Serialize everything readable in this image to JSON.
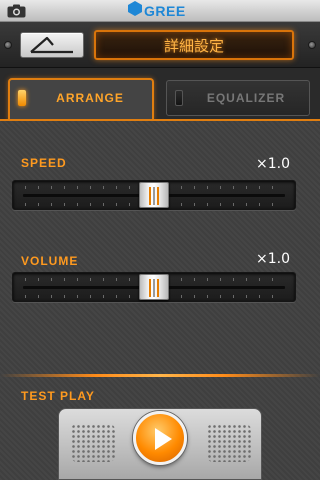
{
  "status_bar": {
    "brand": "GREE",
    "icons": [
      "camera-icon",
      "gree-logo-icon"
    ]
  },
  "header": {
    "title": "詳細設定",
    "back_icon": "back-arrow-icon"
  },
  "tabs": [
    {
      "label": "ARRANGE",
      "active": true
    },
    {
      "label": "EQUALIZER",
      "active": false
    }
  ],
  "speed": {
    "label": "SPEED",
    "value": "×1.0",
    "level": 0.5
  },
  "volume": {
    "label": "VOLUME",
    "value": "×1.0",
    "level": 0.5
  },
  "test_play": {
    "label": "TEST PLAY",
    "icon": "play-icon"
  },
  "colors": {
    "accent": "#ff9a1f",
    "brand": "#1e87d6"
  }
}
